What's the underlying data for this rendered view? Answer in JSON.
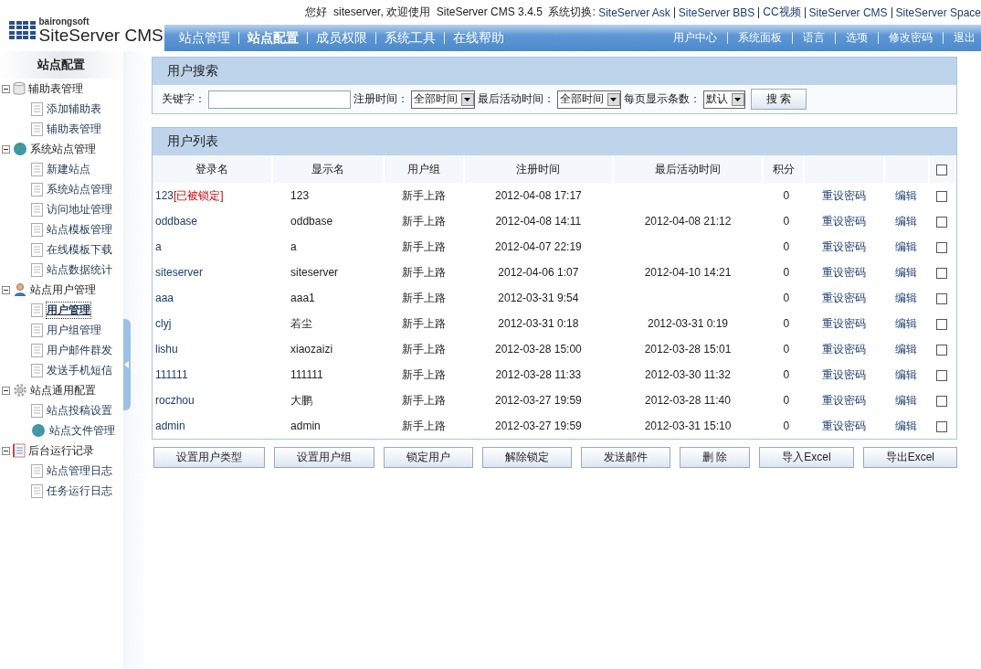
{
  "header": {
    "logo_small": "bairongsoft",
    "logo_name": "SiteServer CMS",
    "greeting": "您好  siteserver, 欢迎使用  SiteServer CMS 3.4.5  系统切换:",
    "switch_links": [
      "SiteServer Ask",
      "SiteServer BBS",
      "CC视频",
      "SiteServer CMS",
      "SiteServer Space"
    ],
    "nav": [
      {
        "label": "站点管理",
        "selected": false
      },
      {
        "label": "站点配置",
        "selected": true
      },
      {
        "label": "成员权限",
        "selected": false
      },
      {
        "label": "系统工具",
        "selected": false
      },
      {
        "label": "在线帮助",
        "selected": false
      }
    ],
    "nav_right": [
      "用户中心",
      "系统面板",
      "语言",
      "选项",
      "修改密码",
      "退出"
    ]
  },
  "sidebar": {
    "title": "站点配置",
    "groups": [
      {
        "label": "辅助表管理",
        "kind": "database",
        "expanded": true,
        "children": [
          {
            "label": "添加辅助表",
            "kind": "page",
            "selected": false
          },
          {
            "label": "辅助表管理",
            "kind": "page",
            "selected": false
          }
        ]
      },
      {
        "label": "系统站点管理",
        "kind": "globe",
        "expanded": true,
        "children": [
          {
            "label": "新建站点",
            "kind": "page",
            "selected": false
          },
          {
            "label": "系统站点管理",
            "kind": "page",
            "selected": false
          },
          {
            "label": "访问地址管理",
            "kind": "page",
            "selected": false
          },
          {
            "label": "站点模板管理",
            "kind": "page",
            "selected": false
          },
          {
            "label": "在线模板下载",
            "kind": "page",
            "selected": false
          },
          {
            "label": "站点数据统计",
            "kind": "page",
            "selected": false
          }
        ]
      },
      {
        "label": "站点用户管理",
        "kind": "user",
        "expanded": true,
        "children": [
          {
            "label": "用户管理",
            "kind": "page",
            "selected": true
          },
          {
            "label": "用户组管理",
            "kind": "page",
            "selected": false
          },
          {
            "label": "用户邮件群发",
            "kind": "page",
            "selected": false
          },
          {
            "label": "发送手机短信",
            "kind": "page",
            "selected": false
          }
        ]
      },
      {
        "label": "站点通用配置",
        "kind": "gear",
        "expanded": true,
        "children": [
          {
            "label": "站点投稿设置",
            "kind": "page",
            "selected": false
          },
          {
            "label": "站点文件管理",
            "kind": "globe",
            "selected": false
          }
        ]
      },
      {
        "label": "后台运行记录",
        "kind": "notebook",
        "expanded": true,
        "children": [
          {
            "label": "站点管理日志",
            "kind": "page",
            "selected": false
          },
          {
            "label": "任务运行日志",
            "kind": "page",
            "selected": false
          }
        ]
      }
    ]
  },
  "search_panel": {
    "title": "用户搜索",
    "keyword_label": "关键字：",
    "reg_label": "注册时间：",
    "reg_value": "全部时间",
    "active_label": "最后活动时间：",
    "active_value": "全部时间",
    "page_label": "每页显示条数：",
    "page_value": "默认",
    "search_button": "搜 索"
  },
  "user_table": {
    "title": "用户列表",
    "columns": [
      "登录名",
      "显示名",
      "用户组",
      "注册时间",
      "最后活动时间",
      "积分"
    ],
    "select_all_checked": false,
    "rows": [
      {
        "login": "123",
        "lock_tag": "[已被锁定]",
        "display": "123",
        "group": "新手上路",
        "registered": "2012-04-08 17:17",
        "points": "0",
        "reset": "重设密码",
        "edit": "编辑",
        "checked": false
      },
      {
        "login": "oddbase",
        "display": "oddbase",
        "group": "新手上路",
        "registered": "2012-04-08 14:11",
        "last_active": "2012-04-08 21:12",
        "points": "0",
        "reset": "重设密码",
        "edit": "编辑",
        "checked": false
      },
      {
        "login": "a",
        "display": "a",
        "group": "新手上路",
        "registered": "2012-04-07 22:19",
        "points": "0",
        "reset": "重设密码",
        "edit": "编辑",
        "checked": false
      },
      {
        "login": "siteserver",
        "display": "siteserver",
        "group": "新手上路",
        "registered": "2012-04-06 1:07",
        "last_active": "2012-04-10 14:21",
        "points": "0",
        "reset": "重设密码",
        "edit": "编辑",
        "checked": false
      },
      {
        "login": "aaa",
        "display": "aaa1",
        "group": "新手上路",
        "registered": "2012-03-31 9:54",
        "points": "0",
        "reset": "重设密码",
        "edit": "编辑",
        "checked": false
      },
      {
        "login": "clyj",
        "display": "若尘",
        "group": "新手上路",
        "registered": "2012-03-31 0:18",
        "last_active": "2012-03-31 0:19",
        "points": "0",
        "reset": "重设密码",
        "edit": "编辑",
        "checked": false
      },
      {
        "login": "lishu",
        "display": "xiaozaizi",
        "group": "新手上路",
        "registered": "2012-03-28 15:00",
        "last_active": "2012-03-28 15:01",
        "points": "0",
        "reset": "重设密码",
        "edit": "编辑",
        "checked": false
      },
      {
        "login": "111111",
        "display": "111111",
        "group": "新手上路",
        "registered": "2012-03-28 11:33",
        "last_active": "2012-03-30 11:32",
        "points": "0",
        "reset": "重设密码",
        "edit": "编辑",
        "checked": false
      },
      {
        "login": "roczhou",
        "display": "大鹏",
        "group": "新手上路",
        "registered": "2012-03-27 19:59",
        "last_active": "2012-03-28 11:40",
        "points": "0",
        "reset": "重设密码",
        "edit": "编辑",
        "checked": false
      },
      {
        "login": "admin",
        "display": "admin",
        "group": "新手上路",
        "registered": "2012-03-27 19:59",
        "last_active": "2012-03-31 15:10",
        "points": "0",
        "reset": "重设密码",
        "edit": "编辑",
        "checked": false
      }
    ]
  },
  "actions": [
    "设置用户类型",
    "设置用户组",
    "锁定用户",
    "解除锁定",
    "发送邮件",
    "删 除",
    "导入Excel",
    "导出Excel"
  ]
}
